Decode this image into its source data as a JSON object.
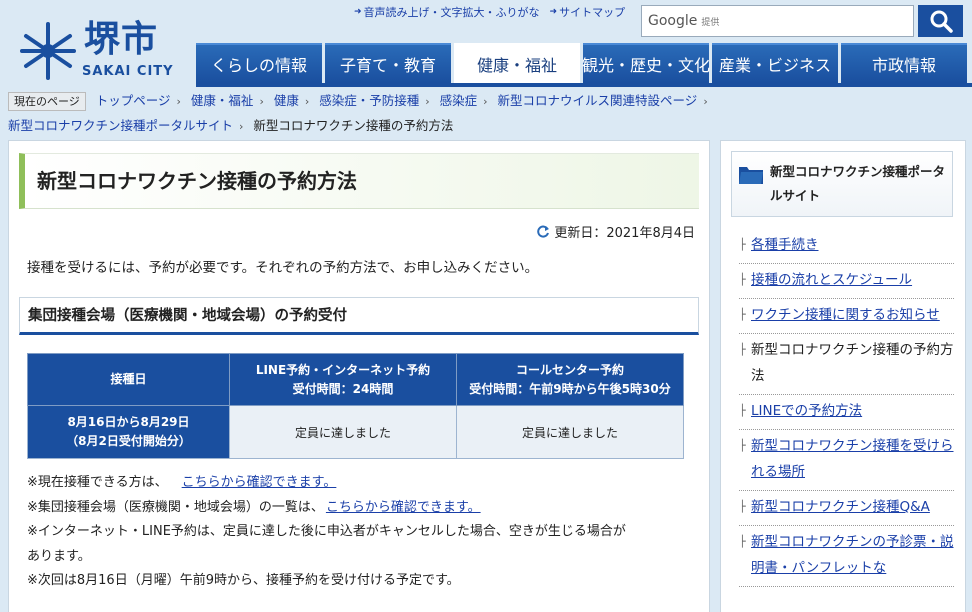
{
  "header": {
    "logo_main": "堺市",
    "logo_sub": "SAKAI CITY",
    "util_links": [
      "音声読み上げ・文字拡大・ふりがな",
      "サイトマップ"
    ],
    "search": {
      "google_label": "Google",
      "provided_label": "提供",
      "button_icon": "magnifier-icon"
    },
    "nav": [
      {
        "label": "くらしの情報",
        "active": false
      },
      {
        "label": "子育て・教育",
        "active": false
      },
      {
        "label": "健康・福祉",
        "active": true
      },
      {
        "label": "観光・歴史・文化",
        "active": false
      },
      {
        "label": "産業・ビジネス",
        "active": false
      },
      {
        "label": "市政情報",
        "active": false
      }
    ]
  },
  "breadcrumb": {
    "here_label": "現在のページ",
    "items": [
      "トップページ",
      "健康・福祉",
      "健康",
      "感染症・予防接種",
      "感染症",
      "新型コロナウイルス関連特設ページ",
      "新型コロナワクチン接種ポータルサイト"
    ],
    "current": "新型コロナワクチン接種の予約方法"
  },
  "main": {
    "title": "新型コロナワクチン接種の予約方法",
    "update_date": "更新日：2021年8月4日",
    "intro": "接種を受けるには、予約が必要です。それぞれの予約方法で、お申し込みください。",
    "sub_heading": "集団接種会場（医療機関・地域会場）の予約受付",
    "table": {
      "col0": "接種日",
      "col1_line1": "LINE予約・インターネット予約",
      "col1_line2": "受付時間：24時間",
      "col2_line1": "コールセンター予約",
      "col2_line2": "受付時間：午前9時から午後5時30分",
      "row_line1": "8月16日から8月29日",
      "row_line2": "（8月2日受付開始分）",
      "row_cell1": "定員に達しました",
      "row_cell2": "定員に達しました"
    },
    "notes": {
      "n1": "※現在接種できる方は、",
      "n1_link": "こちらから確認できます。",
      "n2": "※集団接種会場（医療機関・地域会場）の一覧は、",
      "n2_link": "こちらから確認できます。",
      "n3a": "※インターネット・LINE予約は、定員に達した後に申込者がキャンセルした場合、空きが生じる場合が",
      "n3b": "あります。",
      "n4": "※次回は8月16日（月曜）午前9時から、接種予約を受け付ける予定です。"
    }
  },
  "sidebar": {
    "title": "新型コロナワクチン接種ポータルサイト",
    "items": [
      {
        "label": "各種手続き",
        "link": true
      },
      {
        "label": "接種の流れとスケジュール",
        "link": true
      },
      {
        "label": "ワクチン接種に関するお知らせ",
        "link": true
      },
      {
        "label": "新型コロナワクチン接種の予約方法",
        "link": false
      },
      {
        "label": "LINEでの予約方法",
        "link": true
      },
      {
        "label": "新型コロナワクチン接種を受けられる場所",
        "link": true
      },
      {
        "label": "新型コロナワクチン接種Q&A",
        "link": true
      },
      {
        "label": "新型コロナワクチンの予診票・説明書・パンフレットな",
        "link": true
      }
    ]
  },
  "colors": {
    "brand_blue": "#1a4f9f",
    "accent_green": "#8fbf5a",
    "link": "#1a3fa8"
  }
}
